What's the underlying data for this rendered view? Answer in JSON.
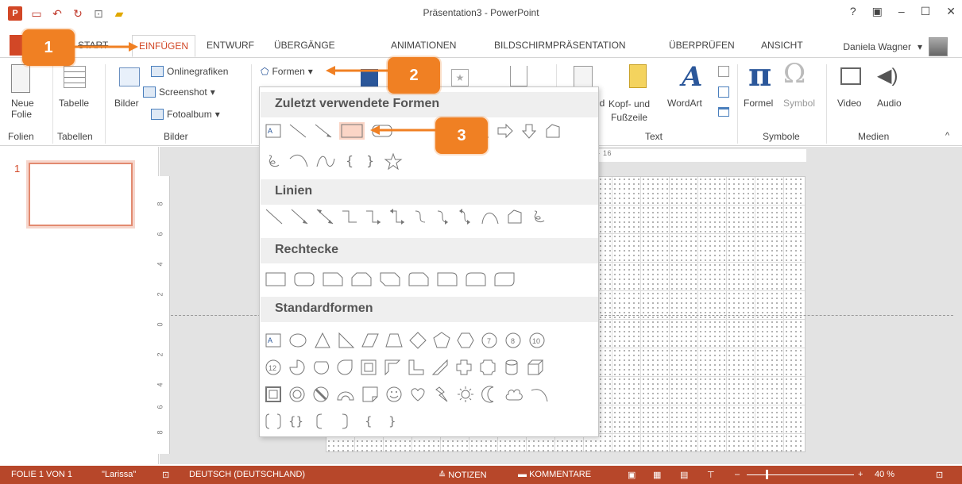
{
  "window": {
    "title": "Präsentation3 - PowerPoint",
    "controls": [
      "?",
      "▣",
      "–",
      "☐",
      "✕"
    ]
  },
  "qat": {
    "logo": "P",
    "icons": [
      "save-icon",
      "undo-icon",
      "redo-icon",
      "start-from-beginning-icon",
      "open-icon"
    ]
  },
  "tabs": {
    "items": [
      "START",
      "EINFÜGEN",
      "ENTWURF",
      "ÜBERGÄNGE",
      "ANIMATIONEN",
      "BILDSCHIRMPRÄSENTATION",
      "ÜBERPRÜFEN",
      "ANSICHT"
    ],
    "active": "EINFÜGEN",
    "user": "Daniela Wagner"
  },
  "ribbon": {
    "neue_folie": "Neue\nFolie",
    "tabelle": "Tabelle",
    "bilder": "Bilder",
    "onlinegrafiken": "Onlinegrafiken",
    "screenshot": "Screenshot",
    "fotoalbum": "Fotoalbum",
    "formen": "Formen",
    "kopf_fusszeile": "Kopf- und\nFußzeile",
    "wordart": "WordArt",
    "text_left": "ld",
    "formel": "Formel",
    "symbol": "Symbol",
    "video": "Video",
    "audio": "Audio",
    "groups": {
      "folien": "Folien",
      "tabellen": "Tabellen",
      "bilder": "Bilder",
      "text": "Text",
      "symbole": "Symbole",
      "medien": "Medien"
    }
  },
  "gallery": {
    "sections": [
      "Zuletzt verwendete Formen",
      "Linien",
      "Rechtecke",
      "Standardformen"
    ]
  },
  "slides": {
    "thumb_number": "1"
  },
  "rulers": {
    "h_text": "· · · 4 · · · 6 · · · 8 · · · 10 · · · 12 · · · 14 · · · 16",
    "v_labels": [
      "8",
      "6",
      "4",
      "2",
      "0",
      "2",
      "4",
      "6",
      "8"
    ]
  },
  "statusbar": {
    "folie": "FOLIE 1 VON 1",
    "theme": "\"Larissa\"",
    "language": "DEUTSCH (DEUTSCHLAND)",
    "notizen": "NOTIZEN",
    "kommentare": "KOMMENTARE",
    "zoom": "40 %"
  },
  "callouts": [
    "1",
    "2",
    "3"
  ],
  "colors": {
    "accent": "#d24726",
    "statusbar": "#b7472a",
    "callout": "#f08023"
  }
}
